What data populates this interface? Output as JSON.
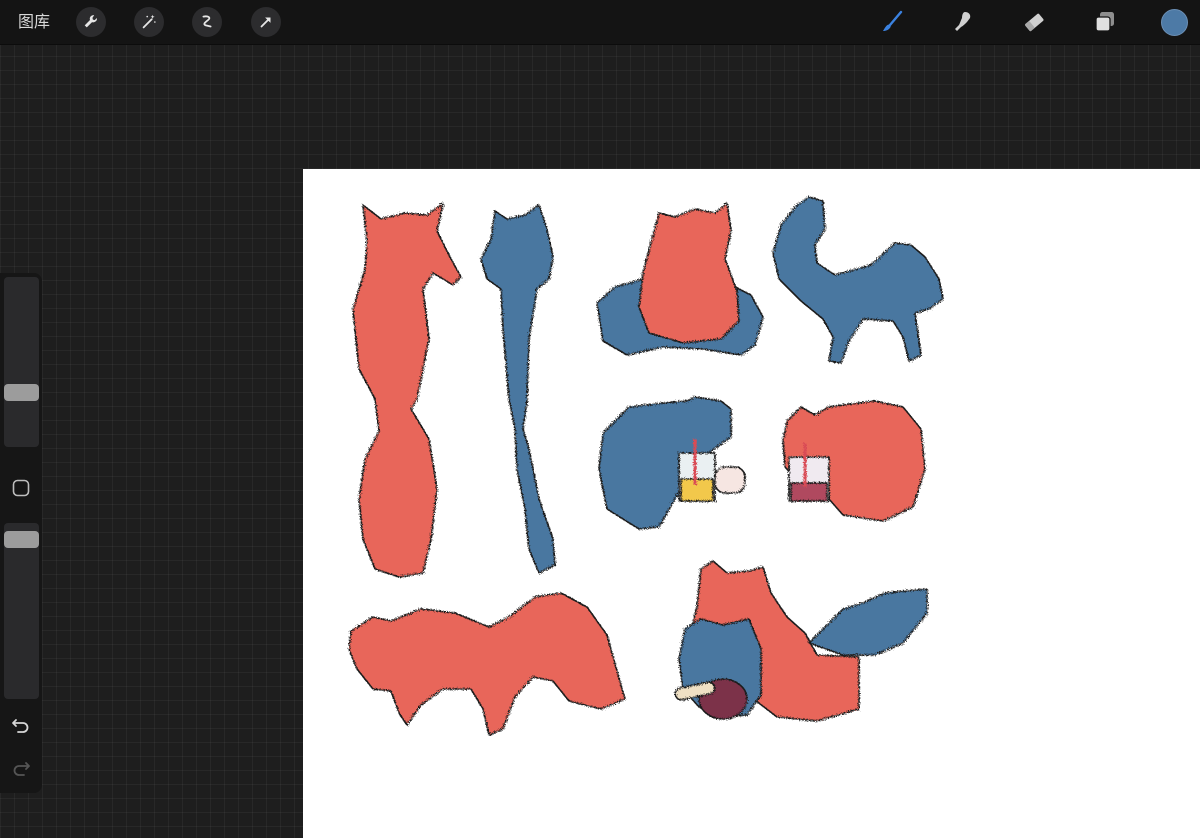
{
  "topbar": {
    "gallery_label": "图库",
    "left_tools": [
      "wrench-icon",
      "magic-wand-icon",
      "selection-icon",
      "transform-arrow-icon"
    ],
    "right_tools": [
      "brush-icon",
      "smudge-icon",
      "eraser-icon",
      "layers-icon"
    ],
    "active_tool": "brush-icon",
    "active_color": "#4d7aa6",
    "active_tool_color": "#3b82e0"
  },
  "sidebar": {
    "brush_size": 0.3,
    "opacity": 0.95
  },
  "canvas": {
    "colors": {
      "red_cat": "#e8665a",
      "blue_cat": "#4a77a0",
      "outline": "#1e1e1e",
      "background": "#ffffff"
    }
  }
}
